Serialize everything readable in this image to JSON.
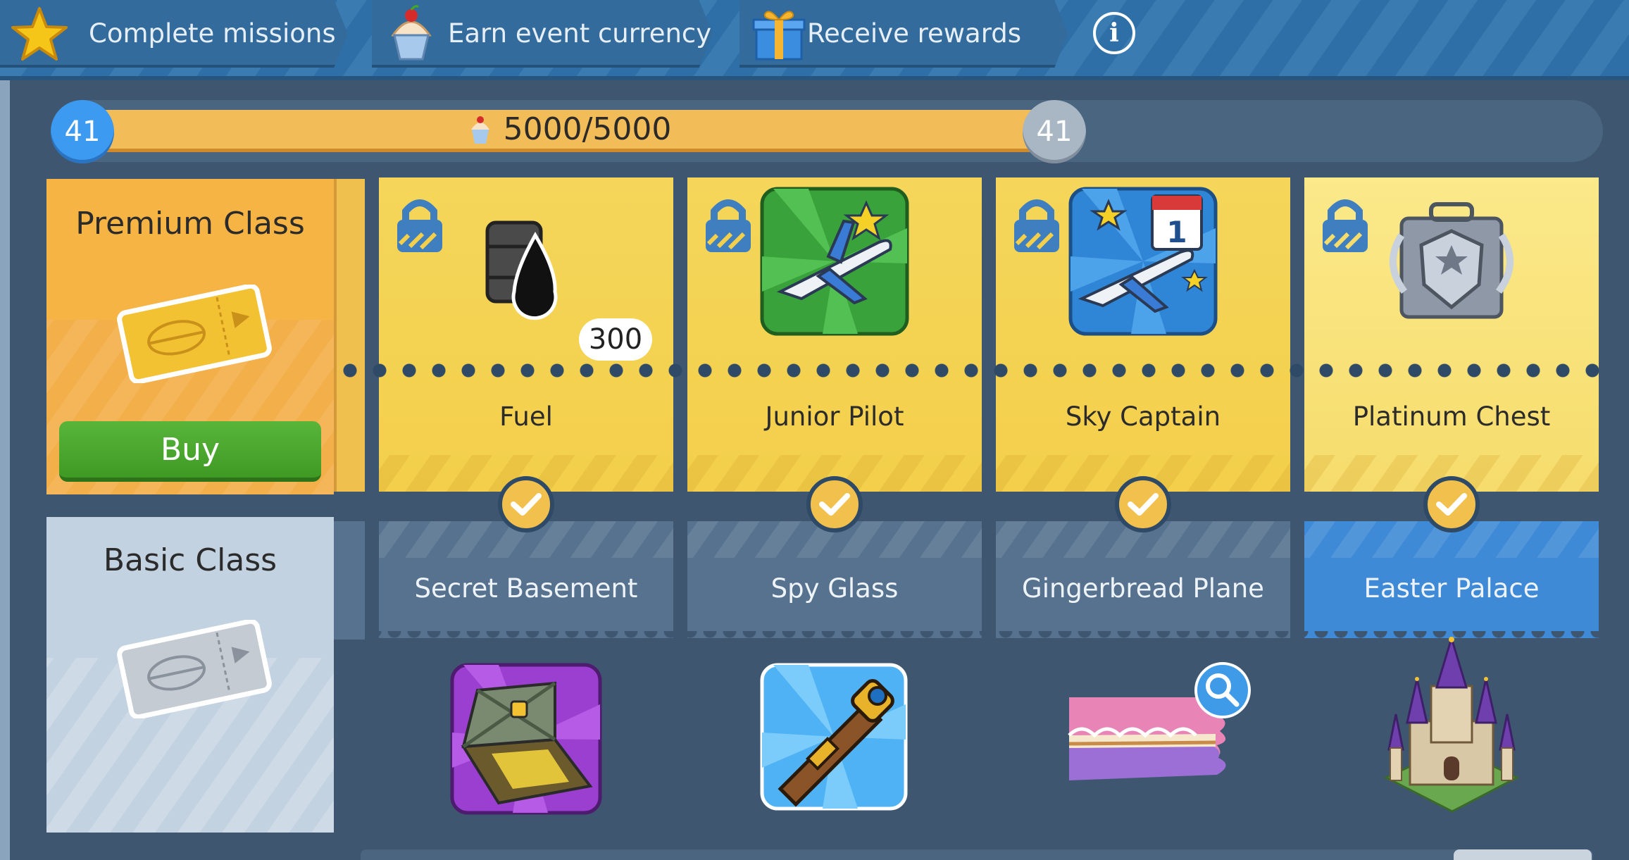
{
  "steps": [
    {
      "label": "Complete missions",
      "icon": "star-icon"
    },
    {
      "label": "Earn event currency",
      "icon": "cupcake-icon"
    },
    {
      "label": "Receive rewards",
      "icon": "gift-icon"
    }
  ],
  "info_icon": "i",
  "progress": {
    "current_level": "41",
    "next_level": "41",
    "text": "5000/5000",
    "fraction": 1.0
  },
  "premium": {
    "title": "Premium Class",
    "buy_label": "Buy"
  },
  "basic": {
    "title": "Basic Class"
  },
  "premium_rewards": [
    {
      "name": "Fuel",
      "quantity": "300",
      "icon": "fuel-barrel-icon",
      "locked": true
    },
    {
      "name": "Junior Pilot",
      "icon": "junior-pilot-plane-icon",
      "locked": true
    },
    {
      "name": "Sky Captain",
      "icon": "sky-captain-plane-icon",
      "locked": true
    },
    {
      "name": "Platinum Chest",
      "icon": "platinum-chest-icon",
      "locked": true
    }
  ],
  "basic_rewards": [
    {
      "name": "Secret Basement",
      "icon": "secret-basement-icon",
      "claimed": true
    },
    {
      "name": "Spy Glass",
      "icon": "spyglass-icon",
      "claimed": true
    },
    {
      "name": "Gingerbread Plane",
      "icon": "gingerbread-plane-icon",
      "claimed": true
    },
    {
      "name": "Easter Palace",
      "icon": "easter-palace-icon",
      "claimed": true
    }
  ],
  "colors": {
    "accent_blue": "#3c9af0",
    "premium_orange": "#f6b444",
    "card_yellow": "#f5d65a",
    "buy_green": "#4aa82e",
    "basic_active": "#3f8ad6"
  }
}
